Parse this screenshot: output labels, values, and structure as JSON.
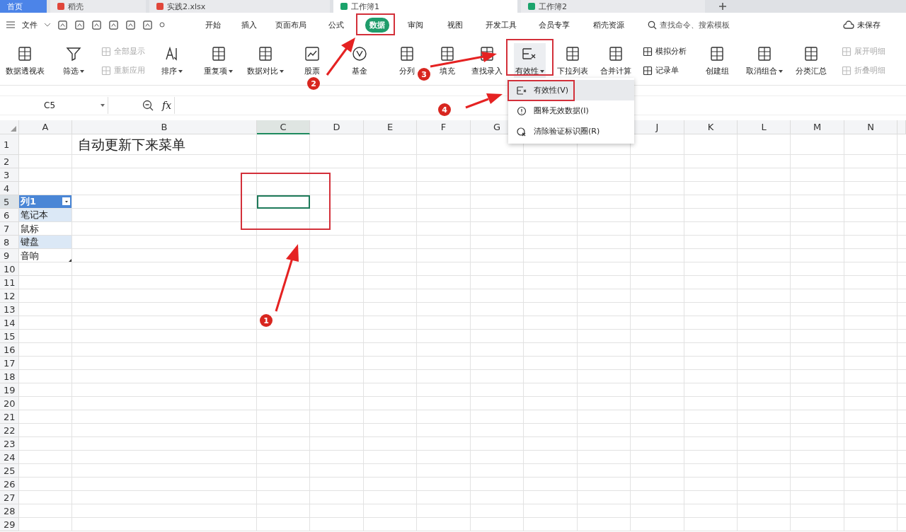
{
  "tabs": [
    {
      "label": "首页",
      "selected": false,
      "kind": "home"
    },
    {
      "label": "稻壳",
      "selected": false,
      "kind": "doc"
    },
    {
      "label": "实践2.xlsx",
      "selected": false,
      "kind": "doc"
    },
    {
      "label": "工作簿1",
      "selected": true,
      "kind": "sheet"
    },
    {
      "label": "工作簿2",
      "selected": false,
      "kind": "sheet"
    }
  ],
  "menu": {
    "file": "文件",
    "items": [
      {
        "label": "开始",
        "selected": false
      },
      {
        "label": "插入",
        "selected": false
      },
      {
        "label": "页面布局",
        "selected": false
      },
      {
        "label": "公式",
        "selected": false
      },
      {
        "label": "数据",
        "selected": true
      },
      {
        "label": "审阅",
        "selected": false
      },
      {
        "label": "视图",
        "selected": false
      },
      {
        "label": "开发工具",
        "selected": false
      },
      {
        "label": "会员专享",
        "selected": false
      },
      {
        "label": "稻壳资源",
        "selected": false
      }
    ],
    "search": "查找命令、搜索模板",
    "save_status": "未保存"
  },
  "ribbon": [
    {
      "kind": "large",
      "label": "数据透视表",
      "dropdown": false,
      "selected": false
    },
    {
      "kind": "large",
      "label": "筛选",
      "dropdown": true,
      "selected": false
    },
    {
      "kind": "stack",
      "items": [
        {
          "label": "全部显示",
          "disabled": true
        },
        {
          "label": "重新应用",
          "disabled": true
        }
      ]
    },
    {
      "kind": "large",
      "label": "排序",
      "dropdown": true,
      "selected": false
    },
    {
      "kind": "large",
      "label": "重复项",
      "dropdown": true,
      "selected": false
    },
    {
      "kind": "large",
      "label": "数据对比",
      "dropdown": true,
      "selected": false
    },
    {
      "kind": "large",
      "label": "股票",
      "dropdown": false,
      "selected": false
    },
    {
      "kind": "large",
      "label": "基金",
      "dropdown": false,
      "selected": false
    },
    {
      "kind": "large",
      "label": "分列",
      "dropdown": false,
      "selected": false
    },
    {
      "kind": "large",
      "label": "填充",
      "dropdown": false,
      "selected": false
    },
    {
      "kind": "large",
      "label": "查找录入",
      "dropdown": false,
      "selected": false
    },
    {
      "kind": "large",
      "label": "有效性",
      "dropdown": true,
      "selected": true
    },
    {
      "kind": "large",
      "label": "下拉列表",
      "dropdown": false,
      "selected": false
    },
    {
      "kind": "large",
      "label": "合并计算",
      "dropdown": false,
      "selected": false
    },
    {
      "kind": "stack",
      "items": [
        {
          "label": "模拟分析",
          "disabled": false
        },
        {
          "label": "记录单",
          "disabled": false
        }
      ]
    },
    {
      "kind": "large",
      "label": "创建组",
      "dropdown": false,
      "selected": false
    },
    {
      "kind": "large",
      "label": "取消组合",
      "dropdown": true,
      "selected": false
    },
    {
      "kind": "large",
      "label": "分类汇总",
      "dropdown": false,
      "selected": false
    },
    {
      "kind": "stack",
      "items": [
        {
          "label": "展开明细",
          "disabled": true
        },
        {
          "label": "折叠明细",
          "disabled": true
        }
      ]
    }
  ],
  "dropdown_menu": [
    {
      "label": "有效性(V)",
      "selected": true
    },
    {
      "label": "圈释无效数据(I)",
      "selected": false
    },
    {
      "label": "清除验证标识圈(R)",
      "selected": false
    }
  ],
  "name_box": "C5",
  "formula_label": "fx",
  "columns": [
    {
      "kind": "letter",
      "label": "A",
      "selected": false
    },
    {
      "kind": "letter",
      "label": "B",
      "selected": false
    },
    {
      "kind": "letter",
      "label": "C",
      "selected": true
    },
    {
      "kind": "letter",
      "label": "D",
      "selected": false
    },
    {
      "kind": "letter",
      "label": "E",
      "selected": false
    },
    {
      "kind": "letter",
      "label": "F",
      "selected": false
    },
    {
      "kind": "letter",
      "label": "G",
      "selected": false
    },
    {
      "kind": "covered"
    },
    {
      "kind": "covered"
    },
    {
      "kind": "letter",
      "label": "J",
      "selected": false
    },
    {
      "kind": "letter",
      "label": "K",
      "selected": false
    },
    {
      "kind": "letter",
      "label": "L",
      "selected": false
    },
    {
      "kind": "letter",
      "label": "M",
      "selected": false
    },
    {
      "kind": "letter",
      "label": "N",
      "selected": false
    }
  ],
  "rows": [
    {
      "label": "1",
      "selected": false
    },
    {
      "label": "2",
      "selected": false
    },
    {
      "label": "3",
      "selected": false
    },
    {
      "label": "4",
      "selected": false
    },
    {
      "label": "5",
      "selected": true
    },
    {
      "label": "6",
      "selected": false
    },
    {
      "label": "7",
      "selected": false
    },
    {
      "label": "8",
      "selected": false
    },
    {
      "label": "9",
      "selected": false
    },
    {
      "label": "10",
      "selected": false
    },
    {
      "label": "11",
      "selected": false
    },
    {
      "label": "12",
      "selected": false
    },
    {
      "label": "13",
      "selected": false
    },
    {
      "label": "14",
      "selected": false
    },
    {
      "label": "15",
      "selected": false
    },
    {
      "label": "16",
      "selected": false
    },
    {
      "label": "17",
      "selected": false
    },
    {
      "label": "18",
      "selected": false
    },
    {
      "label": "19",
      "selected": false
    },
    {
      "label": "20",
      "selected": false
    },
    {
      "label": "21",
      "selected": false
    },
    {
      "label": "22",
      "selected": false
    },
    {
      "label": "23",
      "selected": false
    },
    {
      "label": "24",
      "selected": false
    },
    {
      "label": "25",
      "selected": false
    },
    {
      "label": "26",
      "selected": false
    },
    {
      "label": "27",
      "selected": false
    },
    {
      "label": "28",
      "selected": false
    },
    {
      "label": "29",
      "selected": false
    }
  ],
  "title_cell": "自动更新下来菜单",
  "table": {
    "header": "列1",
    "rows": [
      "笔记本",
      "鼠标",
      "键盘",
      "音响"
    ]
  },
  "markers": [
    {
      "label": "1"
    },
    {
      "label": "2"
    },
    {
      "label": "3"
    },
    {
      "label": "4"
    }
  ]
}
